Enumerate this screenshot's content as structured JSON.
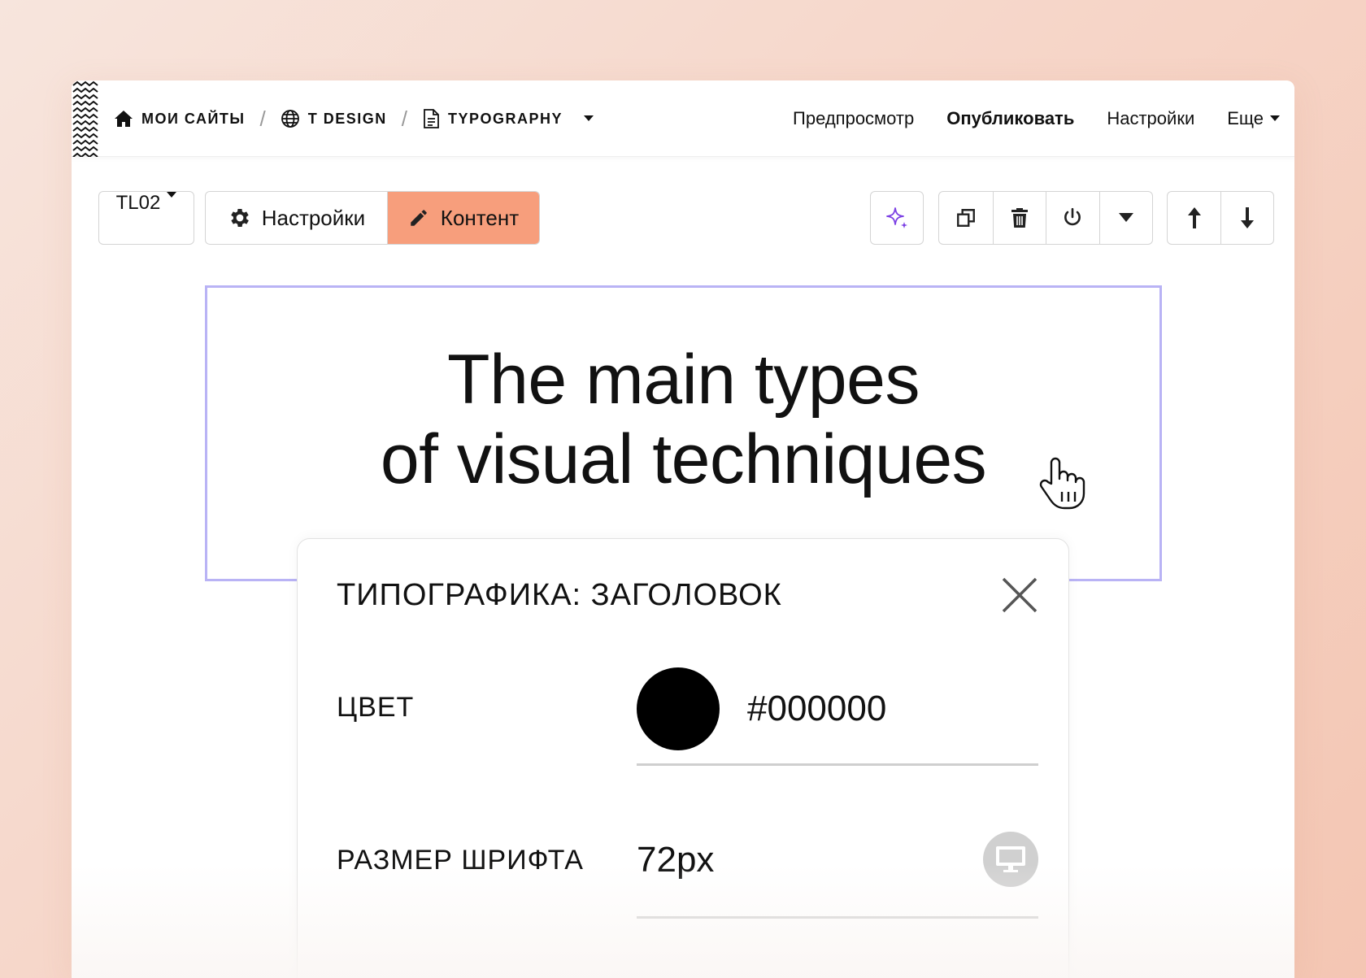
{
  "breadcrumbs": [
    {
      "label": "МОИ САЙТЫ",
      "icon": "home-icon"
    },
    {
      "label": "T DESIGN",
      "icon": "globe-icon"
    },
    {
      "label": "TYPOGRAPHY",
      "icon": "page-icon"
    }
  ],
  "breadcrumb_separator": "/",
  "topnav": {
    "preview": "Предпросмотр",
    "publish": "Опубликовать",
    "settings": "Настройки",
    "more": "Еще"
  },
  "toolbar": {
    "block_code": "TL02",
    "settings_label": "Настройки",
    "content_label": "Контент",
    "accent_color": "#f79e7c",
    "ai_color": "#7b3fe4"
  },
  "heading": {
    "line1": "The main types",
    "line2": "of visual techniques"
  },
  "panel": {
    "title": "ТИПОГРАФИКА: ЗАГОЛОВОК",
    "color_label": "ЦВЕТ",
    "color_value": "#000000",
    "size_label": "РАЗМЕР ШРИФТА",
    "size_value": "72px"
  }
}
